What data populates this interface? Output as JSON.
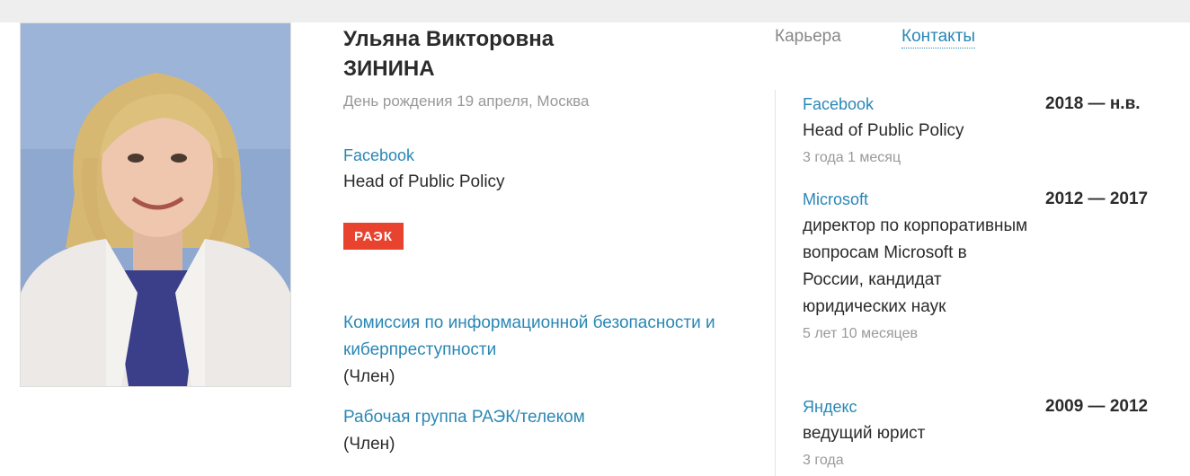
{
  "profile": {
    "first_names": "Ульяна Викторовна",
    "last_name": "ЗИНИНА",
    "birthday": "День рождения 19 апреля, Москва",
    "company": "Facebook",
    "position": "Head of Public Policy",
    "badge": "РАЭК",
    "badge_color": "#e8432f"
  },
  "memberships": [
    {
      "name": "Комиссия по информационной безопасности и киберпреступности",
      "role": "(Член)"
    },
    {
      "name": "Рабочая группа РАЭК/телеком",
      "role": "(Член)"
    }
  ],
  "tabs": [
    {
      "label": "Карьера",
      "active": false
    },
    {
      "label": "Контакты",
      "active": true
    }
  ],
  "career": [
    {
      "company": "Facebook",
      "title": "Head of Public Policy",
      "duration": "3 года 1 месяц",
      "period": "2018 — н.в."
    },
    {
      "company": "Microsoft",
      "title": "директор по корпоративным вопросам Microsoft в России, кандидат юридических наук",
      "duration": "5 лет 10 месяцев",
      "period": "2012 — 2017"
    },
    {
      "company": "Яндекс",
      "title": "ведущий юрист",
      "duration": "3 года",
      "period": "2009 — 2012"
    }
  ],
  "colors": {
    "link": "#2a87b5",
    "text": "#2b2b2b",
    "muted": "#999999",
    "top_bar": "#eeeeee"
  }
}
